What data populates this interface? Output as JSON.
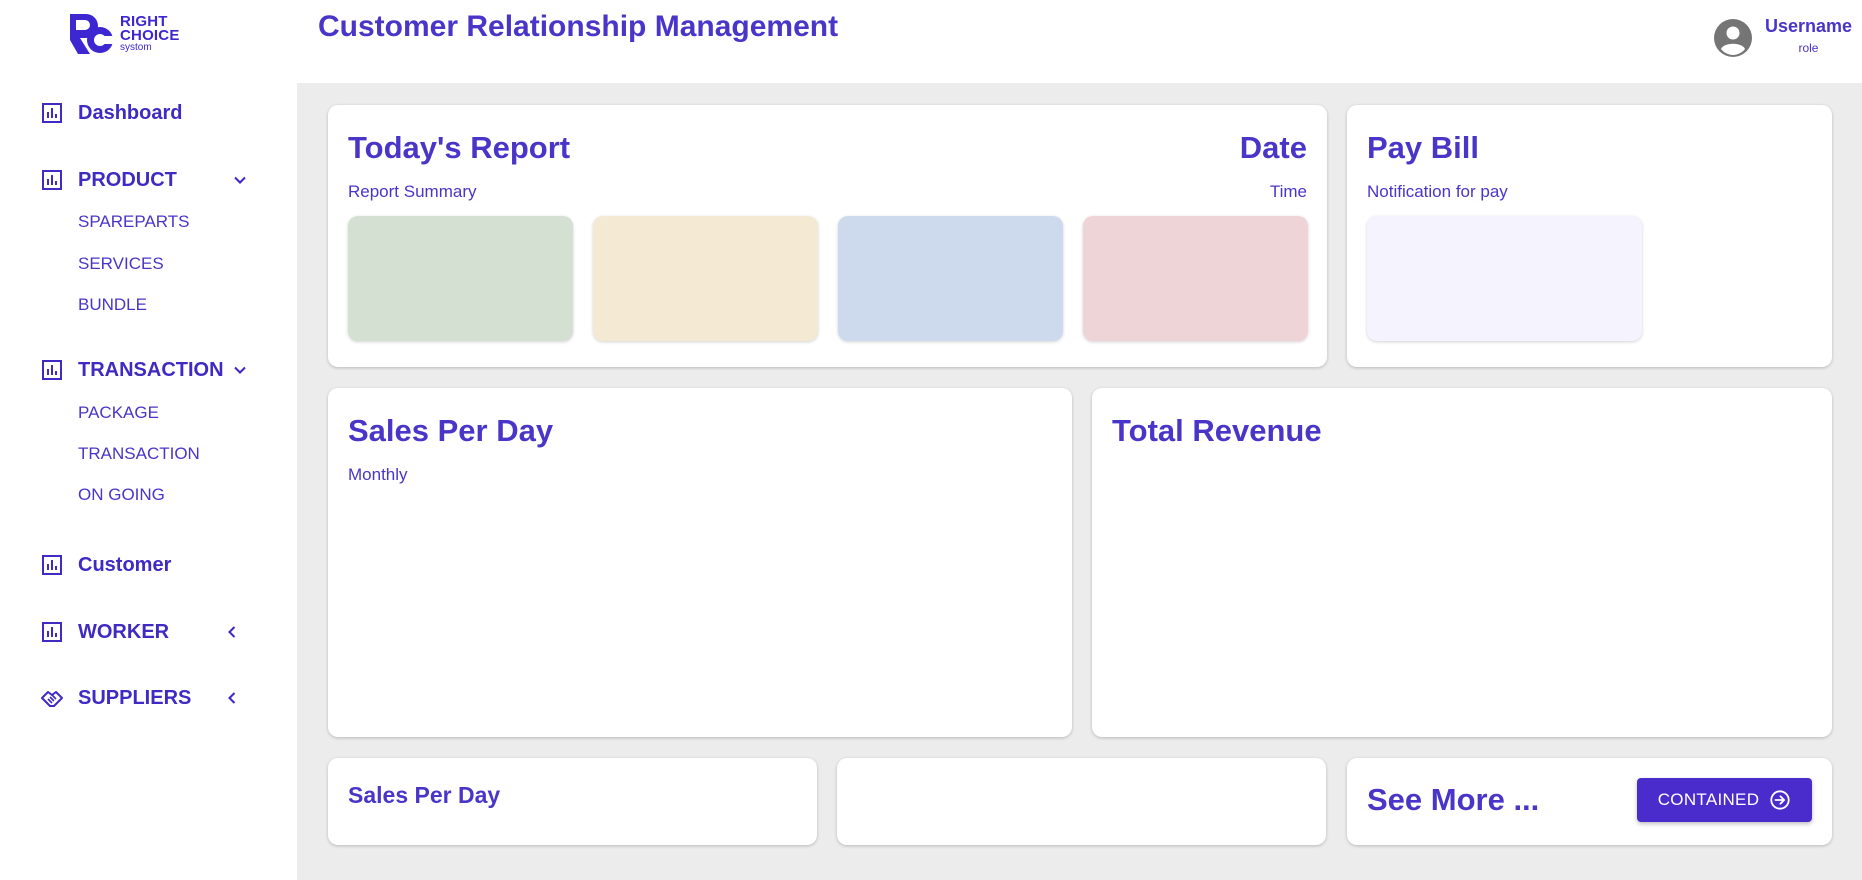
{
  "brand": {
    "line1": "RIGHT",
    "line2": "CHOICE",
    "line3": "systom",
    "monogram": "RC"
  },
  "header": {
    "title": "Customer Relationship Management"
  },
  "user": {
    "name": "Username",
    "role": "role",
    "icon": "account-circle-icon"
  },
  "sidebar": {
    "dashboard": {
      "label": "Dashboard",
      "icon": "bar-chart-icon"
    },
    "product": {
      "label": "PRODUCT",
      "icon": "bar-chart-icon",
      "expanded": true,
      "items": [
        "SPAREPARTS",
        "SERVICES",
        "BUNDLE"
      ]
    },
    "transaction": {
      "label": "TRANSACTION",
      "icon": "bar-chart-icon",
      "expanded": true,
      "items": [
        "PACKAGE",
        "TRANSACTION",
        "ON GOING"
      ]
    },
    "customer": {
      "label": "Customer",
      "icon": "bar-chart-icon"
    },
    "worker": {
      "label": "WORKER",
      "icon": "bar-chart-icon",
      "expanded": false
    },
    "suppliers": {
      "label": "SUPPLIERS",
      "icon": "handshake-icon",
      "expanded": false
    }
  },
  "cards": {
    "today_report": {
      "title": "Today's Report",
      "subtitle": "Report Summary",
      "date": "Date",
      "time": "Time",
      "tile_colors": [
        "#d3e0d2",
        "#f4e9d3",
        "#cdd9ed",
        "#efd4d7"
      ]
    },
    "pay_bill": {
      "title": "Pay Bill",
      "subtitle": "Notification for pay",
      "tile_color": "#f4f3fe"
    },
    "sales_per_day": {
      "title": "Sales Per Day",
      "subtitle": "Monthly"
    },
    "total_revenue": {
      "title": "Total Revenue"
    },
    "sales_small": {
      "title": "Sales Per Day"
    },
    "see_more": {
      "title": "See More ...",
      "button_label": "CONTAINED",
      "button_icon": "arrow-circle-right-icon"
    }
  },
  "colors": {
    "accent": "#4a35c9",
    "button": "#4a2ccc",
    "background": "#ececec"
  }
}
